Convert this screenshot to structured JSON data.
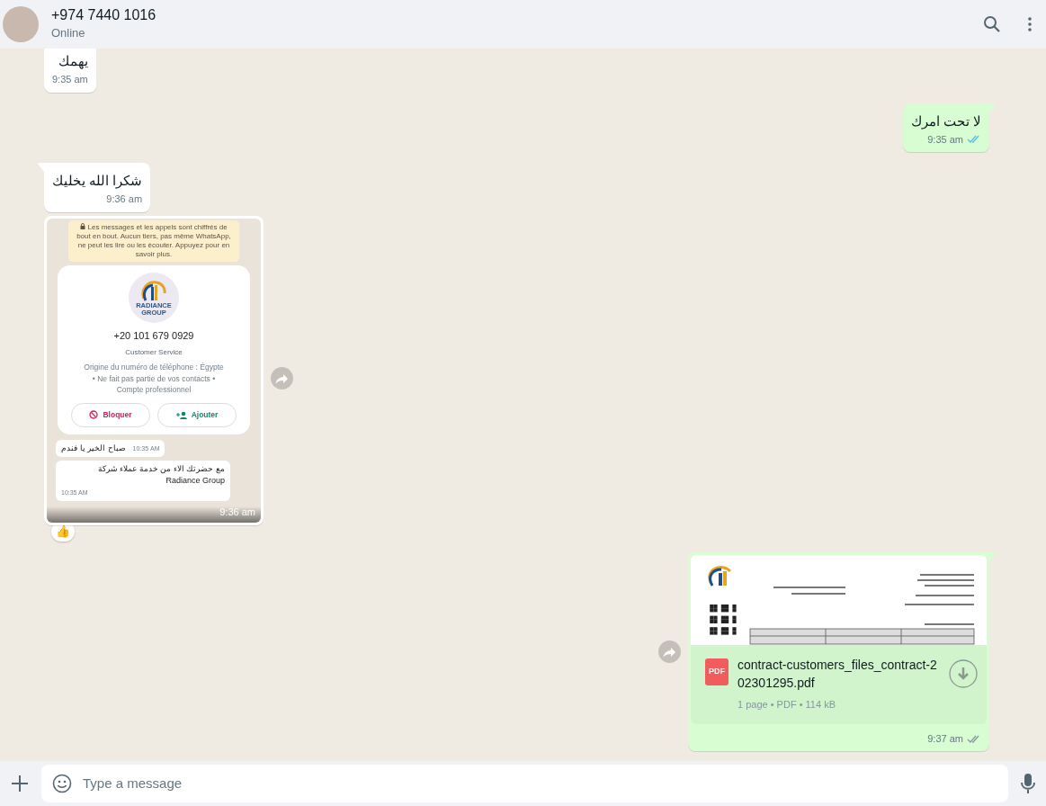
{
  "header": {
    "title": "+974 7440 1016",
    "status": "Online"
  },
  "messages": [
    {
      "kind": "text",
      "outgoing": false,
      "tail": false,
      "text": "يهمك",
      "time": "9:35 am"
    },
    {
      "kind": "text",
      "outgoing": true,
      "tail": true,
      "text": "لا تحت امرك",
      "time": "9:35 am",
      "read": true
    },
    {
      "kind": "text",
      "outgoing": false,
      "tail": true,
      "text": "شكرا الله يخليك",
      "time": "9:36 am"
    },
    {
      "kind": "image",
      "outgoing": false,
      "tail": false,
      "time": "9:36 am",
      "reaction": "👍",
      "screenshot": {
        "notice": "Les messages et les appels sont chiffrés de bout en bout. Aucun tiers, pas même WhatsApp, ne peut les lire ou les écouter. Appuyez pour en savoir plus.",
        "contact": {
          "logo_lines": [
            "RADIANCE",
            "GROUP"
          ],
          "phone": "+20 101 679 0929",
          "label": "Customer Service",
          "details": [
            "Origine du numéro de téléphone : Égypte",
            "• Ne fait pas partie de vos contacts •",
            "Compte professionnel"
          ],
          "actions": [
            {
              "kind": "block",
              "label": "Bloquer"
            },
            {
              "kind": "add",
              "label": "Ajouter"
            }
          ]
        },
        "messages": [
          {
            "lines": [
              "صباح الخير يا فندم"
            ],
            "time": "10:35 AM"
          },
          {
            "lines": [
              "مع حضرتك الاء من خدمة عملاء شركة",
              "Radiance Group"
            ],
            "time": "10:35 AM"
          }
        ]
      }
    },
    {
      "kind": "document",
      "outgoing": true,
      "tail": true,
      "icon_label": "PDF",
      "file_name": "contract-customers_files_contract-202301295.pdf",
      "meta": "1 page • PDF • 114 kB",
      "time": "9:37 am",
      "read": false
    }
  ],
  "composer": {
    "placeholder": "Type a message"
  }
}
